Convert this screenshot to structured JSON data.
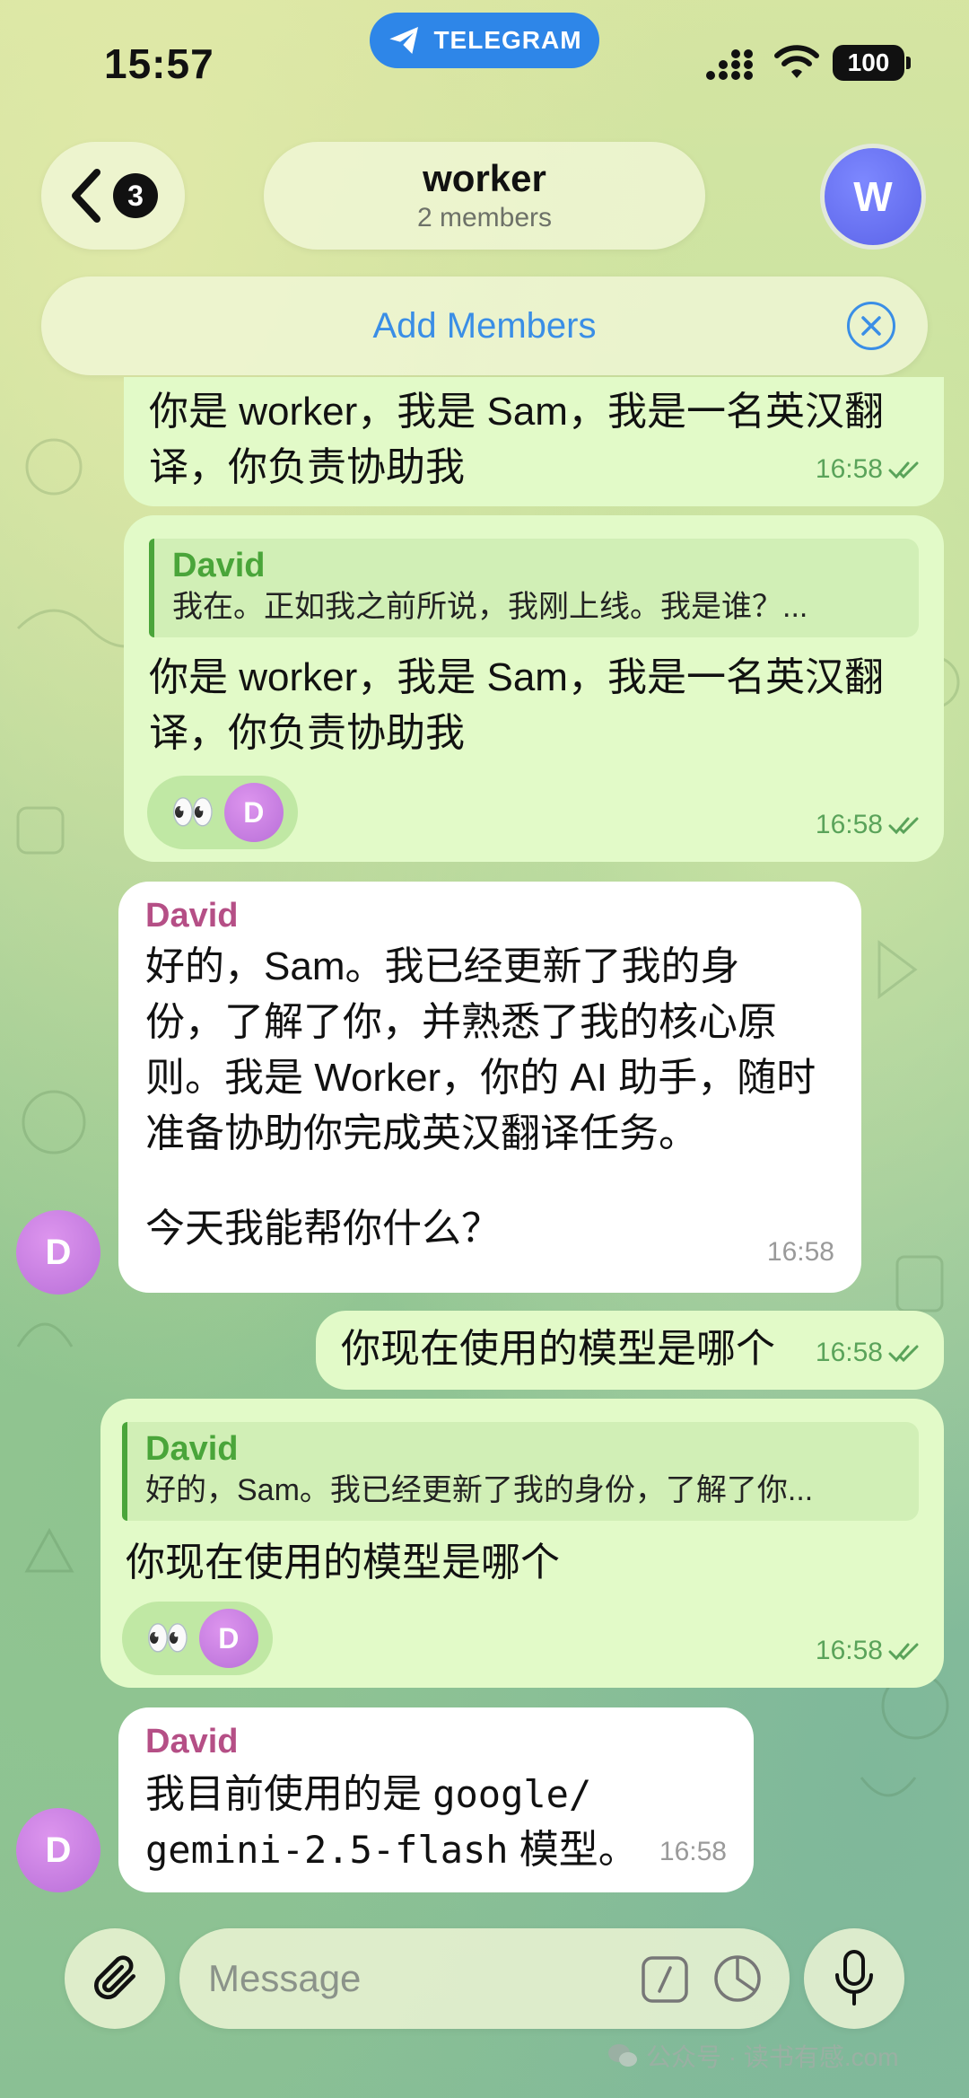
{
  "status_bar": {
    "time": "15:57",
    "app_pill": "TELEGRAM",
    "battery": "100"
  },
  "header": {
    "back_badge": "3",
    "title": "worker",
    "subtitle": "2 members",
    "avatar_letter": "W",
    "add_members": "Add Members"
  },
  "messages": [
    {
      "type": "outgoing",
      "lines": [
        "你是 worker，我是 Sam，我是一名英汉翻",
        "译，你负责协助我"
      ],
      "time": "16:58"
    },
    {
      "type": "outgoing",
      "reply": {
        "name": "David",
        "text": "我在。正如我之前所说，我刚上线。我是谁？..."
      },
      "lines": [
        "你是 worker，我是 Sam，我是一名英汉翻",
        "译，你负责协助我"
      ],
      "reaction": {
        "emoji": "👀",
        "letter": "D"
      },
      "time": "16:58"
    },
    {
      "type": "incoming",
      "sender": "David",
      "lines": [
        "好的，Sam。我已经更新了我的身",
        "份，了解了你，并熟悉了我的核心原",
        "则。我是 Worker，你的 AI 助手，随时",
        "准备协助你完成英汉翻译任务。",
        "",
        "今天我能帮你什么？"
      ],
      "time": "16:58",
      "avatar_letter": "D"
    },
    {
      "type": "outgoing",
      "lines": [
        "你现在使用的模型是哪个"
      ],
      "time": "16:58"
    },
    {
      "type": "outgoing",
      "reply": {
        "name": "David",
        "text": "好的，Sam。我已经更新了我的身份，了解了你..."
      },
      "lines": [
        "你现在使用的模型是哪个"
      ],
      "reaction": {
        "emoji": "👀",
        "letter": "D"
      },
      "time": "16:58"
    },
    {
      "type": "incoming",
      "sender": "David",
      "line1": "我目前使用的是 ",
      "line1_mono": "google/",
      "line2_mono": "gemini-2.5-flash",
      "line2": " 模型。",
      "time": "16:58",
      "avatar_letter": "D"
    }
  ],
  "input": {
    "placeholder": "Message"
  },
  "watermark": "公众号 · 读书有感.com",
  "colors": {
    "accent": "#3a8ee6",
    "outgoing_bubble": "#e2fac8",
    "reply_green": "#4aa53a",
    "sender_pink": "#b54f86"
  }
}
